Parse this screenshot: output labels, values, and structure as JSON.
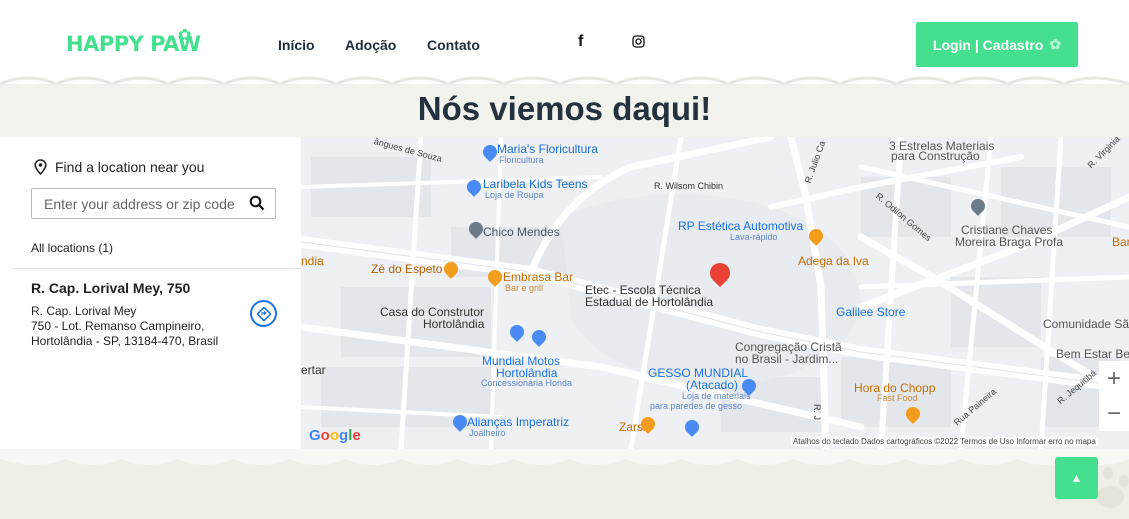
{
  "header": {
    "logo": "HAPPY PAW",
    "nav": [
      "Início",
      "Adoção",
      "Contato"
    ],
    "social": {
      "facebook": "f",
      "instagram_icon": "instagram-icon"
    },
    "login_label": "Login | Cadastro"
  },
  "title": "Nós viemos daqui!",
  "locator": {
    "find_label": "Find a location near you",
    "search_placeholder": "Enter your address or zip code",
    "all_locations": "All locations (1)",
    "location": {
      "name": "R. Cap. Lorival Mey, 750",
      "line1": "R. Cap. Lorival Mey",
      "line2": "750 - Lot. Remanso Campineiro,",
      "line3": "Hortolândia - SP, 13184-470, Brasil"
    }
  },
  "map": {
    "labels": [
      "Maria's Floricultura",
      "Floricultura",
      "Laribela Kids Teens",
      "Loja de Roupa",
      "Chico Mendes",
      "R. Wilsom Chibin",
      "RP Estética Automotiva",
      "Lava-rápido",
      "Adega da Iva",
      "3 Estrelas Materiais",
      "para Construção",
      "Cristiane Chaves",
      "Moreira Braga Profa",
      "Zé do Espeto",
      "Embrasa Bar",
      "Bar e grill",
      "Etec - Escola Técnica",
      "Estadual de Hortolândia",
      "Galilee Store",
      "Comunidade São",
      "Casa do Construtor",
      "Hortolândia",
      "Congregação Cristã",
      "no Brasil - Jardim...",
      "Bem Estar Be",
      "Mundial Motos",
      "Hortolândia",
      "Concessionária Honda",
      "GESSO MUNDIAL",
      "(Atacado)",
      "Loja de materiais",
      "para paredes de gesso",
      "Hora do Chopp",
      "Fast Food",
      "Alianças Imperatriz",
      "Joalheiro",
      "Zars2",
      "R. Julio Ca",
      "R. Odilon Gomes",
      "R. Virginia",
      "R. Jequitibá",
      "Rua Paineira",
      "ângues de Souza",
      "Bar",
      "ndia",
      "ertar",
      "R. J"
    ],
    "credits": "Atalhos do teclado   Dados cartográficos ©2022   Termos de Uso   Informar erro no mapa",
    "google": "Google",
    "zoom_in": "+",
    "zoom_out": "−"
  },
  "colors": {
    "accent": "#45e08f",
    "title": "#243240",
    "map_bg": "#eef0f3",
    "map_blue": "#4a8af4",
    "map_orange": "#f29d1b",
    "pin_red": "#ea4335"
  }
}
